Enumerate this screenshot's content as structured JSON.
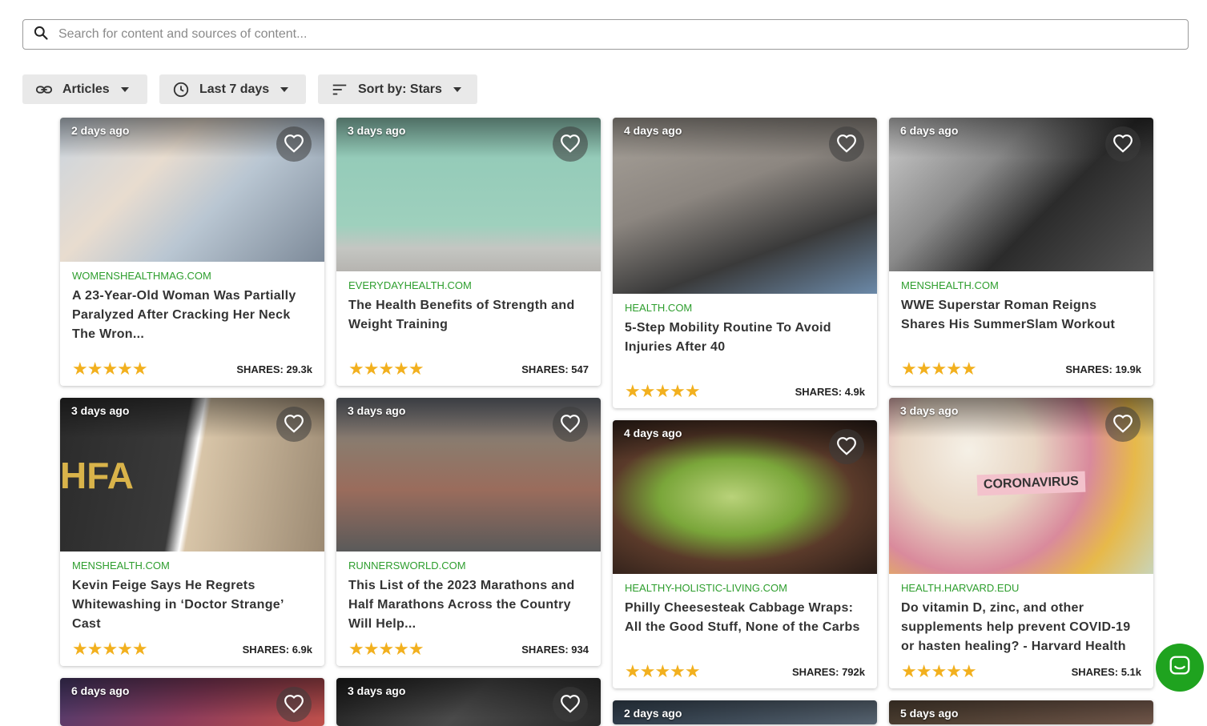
{
  "search": {
    "placeholder": "Search for content and sources of content..."
  },
  "filters": {
    "type_label": "Articles",
    "time_label": "Last 7 days",
    "sort_label": "Sort by: Stars"
  },
  "stars": "★★★★★",
  "cards": [
    {
      "age": "2 days ago",
      "source": "WOMENSHEALTHMAG.COM",
      "title": "A 23-Year-Old Woman Was Partially Paralyzed After Cracking Her Neck The Wron...",
      "shares": "SHARES: 29.3k"
    },
    {
      "age": "3 days ago",
      "source": "EVERYDAYHEALTH.COM",
      "title": "The Health Benefits of Strength and Weight Training",
      "shares": "SHARES: 547"
    },
    {
      "age": "4 days ago",
      "source": "HEALTH.COM",
      "title": "5-Step Mobility Routine To Avoid Injuries After 40",
      "shares": "SHARES: 4.9k"
    },
    {
      "age": "6 days ago",
      "source": "MENSHEALTH.COM",
      "title": "WWE Superstar Roman Reigns Shares His SummerSlam Workout",
      "shares": "SHARES: 19.9k"
    },
    {
      "age": "3 days ago",
      "source": "MENSHEALTH.COM",
      "title": "Kevin Feige Says He Regrets Whitewashing in ‘Doctor Strange’ Cast",
      "shares": "SHARES: 6.9k",
      "overlay": "HFA"
    },
    {
      "age": "3 days ago",
      "source": "RUNNERSWORLD.COM",
      "title": "This List of the 2023 Marathons and Half Marathons Across the Country Will Help...",
      "shares": "SHARES: 934"
    },
    {
      "age": "4 days ago",
      "source": "HEALTHY-HOLISTIC-LIVING.COM",
      "title": "Philly Cheesesteak Cabbage Wraps: All the Good Stuff, None of the Carbs",
      "shares": "SHARES: 792k"
    },
    {
      "age": "3 days ago",
      "source": "HEALTH.HARVARD.EDU",
      "title": "Do vitamin D, zinc, and other supplements help prevent COVID-19 or hasten healing? - Harvard Health",
      "shares": "SHARES: 5.1k",
      "overlay": "CORONAVIRUS"
    },
    {
      "age": "6 days ago"
    },
    {
      "age": "3 days ago"
    },
    {
      "age": "2 days ago"
    },
    {
      "age": "5 days ago"
    }
  ],
  "colors": {
    "source_green": "#2e9e2e",
    "star": "#f2b01e",
    "chat": "#1fa31f"
  },
  "icons": [
    "search-icon",
    "link-icon",
    "clock-icon",
    "sort-icon",
    "heart-icon",
    "chat-icon"
  ]
}
